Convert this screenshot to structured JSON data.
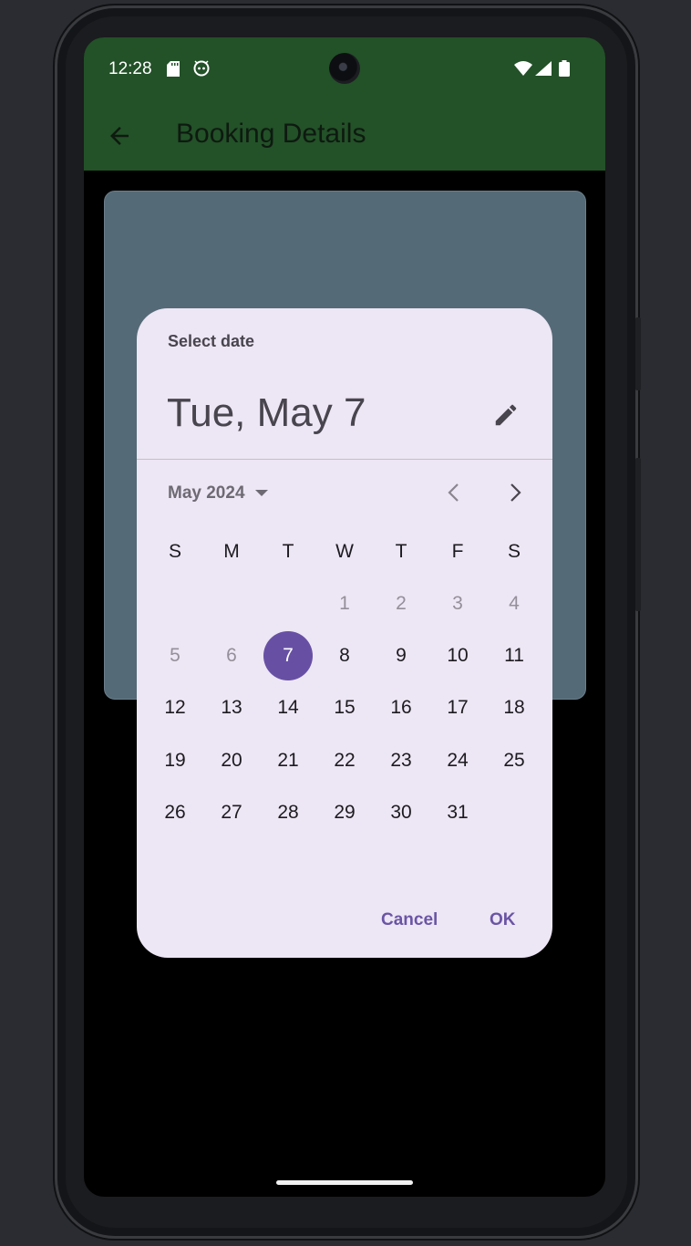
{
  "status_bar": {
    "time": "12:28",
    "icons": [
      "sd-card-icon",
      "android-bot-icon",
      "wifi-icon",
      "signal-icon",
      "battery-icon"
    ]
  },
  "app_bar": {
    "title": "Booking Details",
    "back_icon": "arrow-back-icon",
    "color": "#235128"
  },
  "date_picker": {
    "subtitle": "Select date",
    "selected_date": "Tue, May 7",
    "month_label": "May 2024",
    "weekdays": [
      "S",
      "M",
      "T",
      "W",
      "T",
      "F",
      "S"
    ],
    "weeks": [
      [
        "",
        "",
        "",
        "1",
        "2",
        "3",
        "4"
      ],
      [
        "5",
        "6",
        "7",
        "8",
        "9",
        "10",
        "11"
      ],
      [
        "12",
        "13",
        "14",
        "15",
        "16",
        "17",
        "18"
      ],
      [
        "19",
        "20",
        "21",
        "22",
        "23",
        "24",
        "25"
      ],
      [
        "26",
        "27",
        "28",
        "29",
        "30",
        "31",
        ""
      ]
    ],
    "disabled_days": [
      "1",
      "2",
      "3",
      "4",
      "5",
      "6"
    ],
    "selected_day": "7",
    "cancel_label": "Cancel",
    "ok_label": "OK",
    "accent_color": "#6750a4",
    "surface_color": "#ede6f4"
  }
}
